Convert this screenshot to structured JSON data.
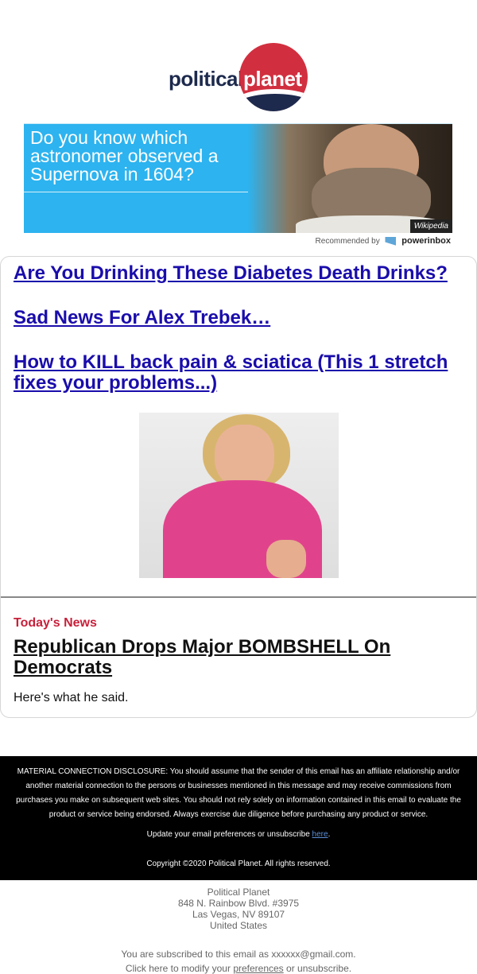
{
  "logo": {
    "part1": "political",
    "part2": "planet"
  },
  "banner": {
    "question": "Do you know which astronomer observed a Supernova in 1604?",
    "source": "Wikipedia",
    "recommended_by": "Recommended by",
    "brand": "powerinbox"
  },
  "articles": [
    {
      "title": "Are You Drinking These Diabetes Death Drinks?"
    },
    {
      "title": "Sad News For Alex Trebek…"
    },
    {
      "title": "How to KILL back pain & sciatica (This 1 stretch fixes your problems...)"
    }
  ],
  "todays_news": {
    "label": "Today's News",
    "title": "Republican Drops Major BOMBSHELL On Democrats",
    "teaser": "Here's what he said."
  },
  "footer": {
    "disclosure": "MATERIAL CONNECTION DISCLOSURE: You should assume that the sender of this email has an affiliate relationship and/or another material connection to the persons or businesses mentioned in this message and may receive commissions from purchases you make on subsequent web sites. You should not rely solely on information contained in this email to evaluate the product or service being endorsed. Always exercise due diligence before purchasing any product or service.",
    "prefs_text": "Update your email preferences or unsubscribe",
    "prefs_link": "here",
    "copyright": "Copyright ©2020 Political Planet. All rights reserved."
  },
  "address": {
    "company": "Political Planet",
    "street": "848 N. Rainbow Blvd. #3975",
    "city": "Las Vegas, NV 89107",
    "country": "United States"
  },
  "subscription": {
    "line1": "You are subscribed to this email as xxxxxx@gmail.com.",
    "click_prefix": "Click here to modify your",
    "preferences_link": "preferences",
    "click_suffix": "or unsubscribe."
  }
}
